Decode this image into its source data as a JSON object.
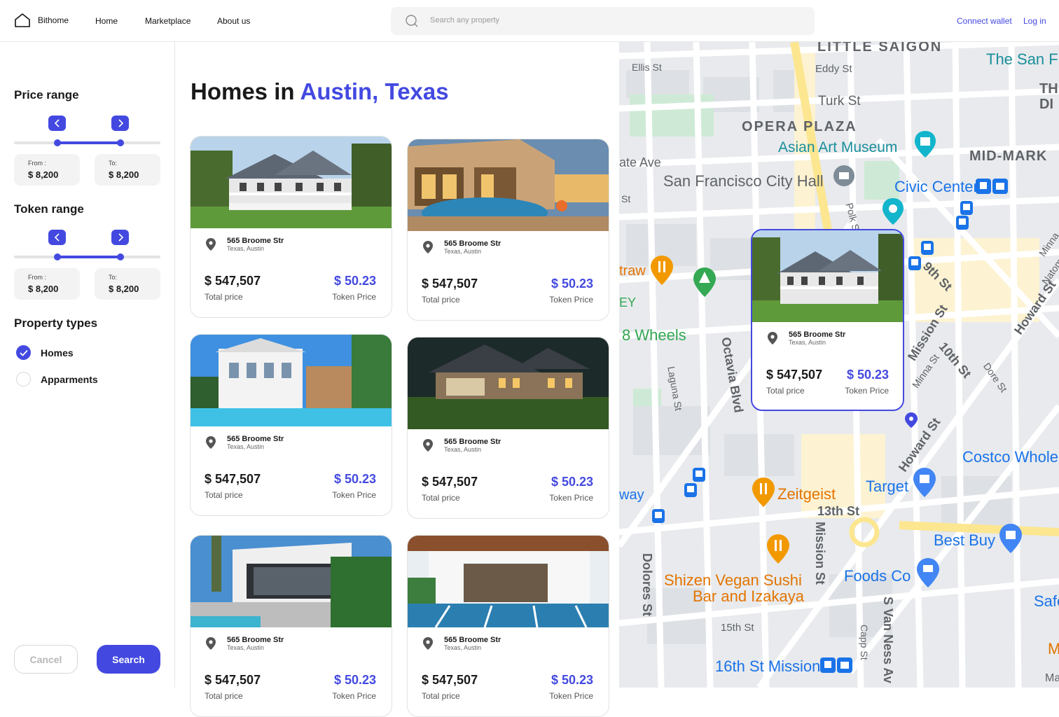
{
  "header": {
    "brand": "Bithome",
    "nav": [
      "Home",
      "Marketplace",
      "About us"
    ],
    "search_placeholder": "Search any property",
    "connect_wallet": "Connect wallet",
    "login": "Log in"
  },
  "filters": {
    "price_range": {
      "title": "Price range",
      "from_label": "From :",
      "from_value": "$ 8,200",
      "to_label": "To:",
      "to_value": "$ 8,200"
    },
    "token_range": {
      "title": "Token range",
      "from_label": "From :",
      "from_value": "$ 8,200",
      "to_label": "To:",
      "to_value": "$ 8,200"
    },
    "property_types": {
      "title": "Property types",
      "options": [
        {
          "label": "Homes",
          "checked": true
        },
        {
          "label": "Apparments",
          "checked": false
        }
      ]
    },
    "cancel": "Cancel",
    "search": "Search"
  },
  "listing": {
    "title_prefix": "Homes in ",
    "title_location": "Austin, Texas",
    "cards": [
      {
        "address": "565 Broome Str",
        "city": "Texas, Austin",
        "price": "$ 547,507",
        "price_label": "Total price",
        "token_price": "$ 50.23",
        "token_label": "Token Price"
      },
      {
        "address": "565 Broome Str",
        "city": "Texas, Austin",
        "price": "$ 547,507",
        "price_label": "Total price",
        "token_price": "$ 50.23",
        "token_label": "Token Price"
      },
      {
        "address": "565 Broome Str",
        "city": "Texas, Austin",
        "price": "$ 547,507",
        "price_label": "Total price",
        "token_price": "$ 50.23",
        "token_label": "Token Price"
      },
      {
        "address": "565 Broome Str",
        "city": "Texas, Austin",
        "price": "$ 547,507",
        "price_label": "Total price",
        "token_price": "$ 50.23",
        "token_label": "Token Price"
      },
      {
        "address": "565 Broome Str",
        "city": "Texas, Austin",
        "price": "$ 547,507",
        "price_label": "Total price",
        "token_price": "$ 50.23",
        "token_label": "Token Price"
      },
      {
        "address": "565 Broome Str",
        "city": "Texas, Austin",
        "price": "$ 547,507",
        "price_label": "Total price",
        "token_price": "$ 50.23",
        "token_label": "Token Price"
      }
    ]
  },
  "map": {
    "labels": {
      "little_saigon": "LITTLE SAIGON",
      "the_san": "The San F",
      "ellis": "Ellis St",
      "eddy": "Eddy St",
      "turk": "Turk St",
      "opera_plaza": "OPERA PLAZA",
      "asian_art": "Asian Art Museum",
      "mid_mark": "MID-MARK",
      "th_di": "TH\nDI",
      "gate_ave": "ate Ave",
      "city_hall": "San Francisco City Hall",
      "civic_center": "Civic Center",
      "st_left": "St",
      "polk": "Polk St",
      "straw": "traw",
      "ey": "EY",
      "wheels": "8 Wheels",
      "octavia": "Octavia Blvd",
      "laguna": "Laguna St",
      "ninth": "9th St",
      "mission": "Mission St",
      "tenth": "10th St",
      "minna": "Minna St",
      "dore": "Dore St",
      "howard_top": "Howard St",
      "howard": "Howard St",
      "costco": "Costco Whole",
      "target": "Target",
      "zeitgeist": "Zeitgeist",
      "way": "way",
      "thirteenth": "13th St",
      "mission_v": "Mission St",
      "best_buy": "Best Buy",
      "dolores": "Dolores St",
      "shizen": "Shizen Vegan Sushi",
      "shizen2": "Bar and Izakaya",
      "foods_co": "Foods Co",
      "safe": "Safe",
      "fifteenth": "15th St",
      "capp": "Capp St",
      "van_ness": "S Van Ness Av",
      "sixteenth": "16th St Mission",
      "minna_r": "Minna",
      "natoma": "Natom",
      "m_r": "M",
      "ma_r": "Ma"
    },
    "popup": {
      "address": "565 Broome Str",
      "city": "Texas, Austin",
      "price": "$ 547,507",
      "price_label": "Total price",
      "token_price": "$ 50.23",
      "token_label": "Token Price"
    }
  },
  "colors": {
    "accent": "#4349e0",
    "map_blue": "#1a73e8",
    "map_teal": "#1a8f9c",
    "map_orange": "#e37400",
    "map_road_yellow": "#fce690"
  }
}
